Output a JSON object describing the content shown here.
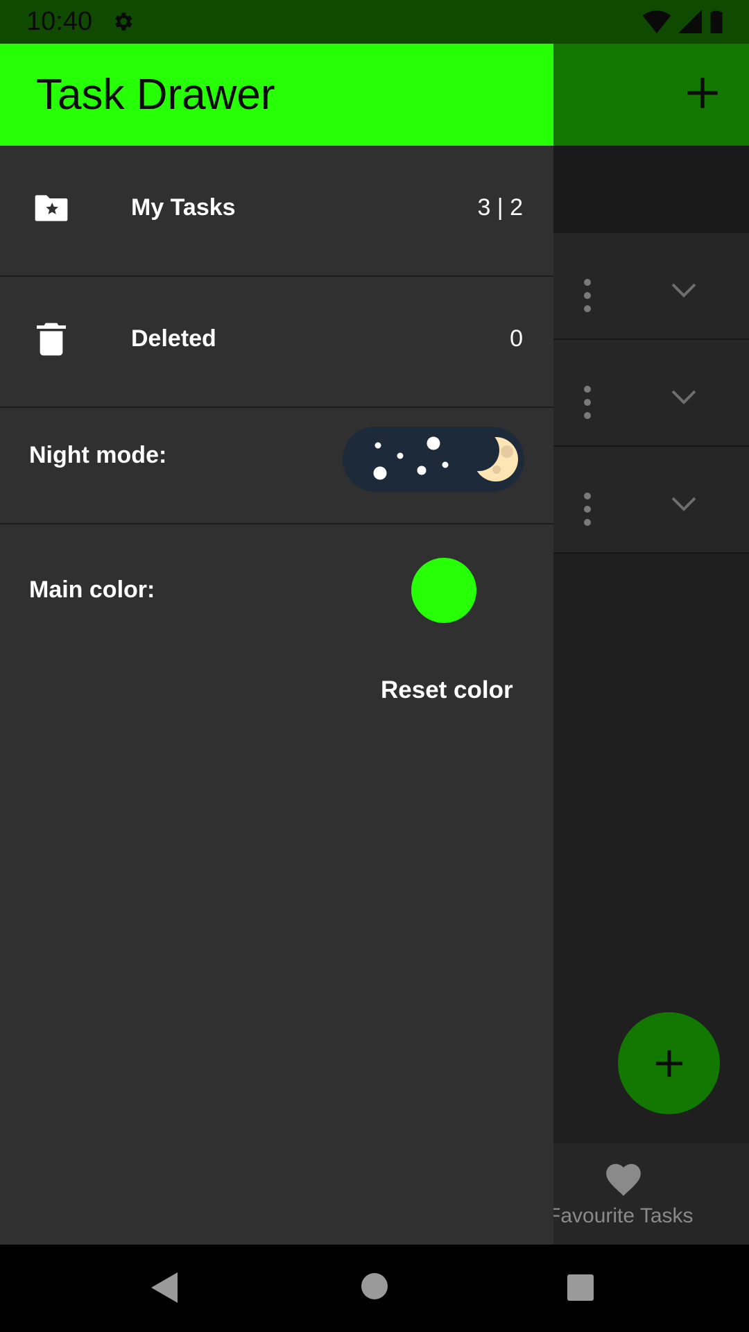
{
  "status_bar": {
    "time": "10:40",
    "icons": [
      "settings-icon",
      "wifi-icon",
      "signal-icon",
      "battery-icon"
    ]
  },
  "background_app": {
    "bottom_nav": {
      "favourite_label": "Favourite Tasks"
    }
  },
  "drawer": {
    "title": "Task Drawer",
    "items": [
      {
        "icon": "folder-star-icon",
        "label": "My Tasks",
        "count": "3 | 2"
      },
      {
        "icon": "trash-icon",
        "label": "Deleted",
        "count": "0"
      }
    ],
    "night_mode": {
      "label": "Night mode:",
      "enabled": true
    },
    "main_color": {
      "label": "Main color:",
      "value": "#26ff06"
    },
    "reset_label": "Reset color"
  },
  "colors": {
    "accent": "#26ff06",
    "accent_dark": "#127800",
    "drawer_bg": "#303030"
  },
  "nav_bar": {
    "icons": [
      "back-icon",
      "home-icon",
      "recents-icon"
    ]
  }
}
